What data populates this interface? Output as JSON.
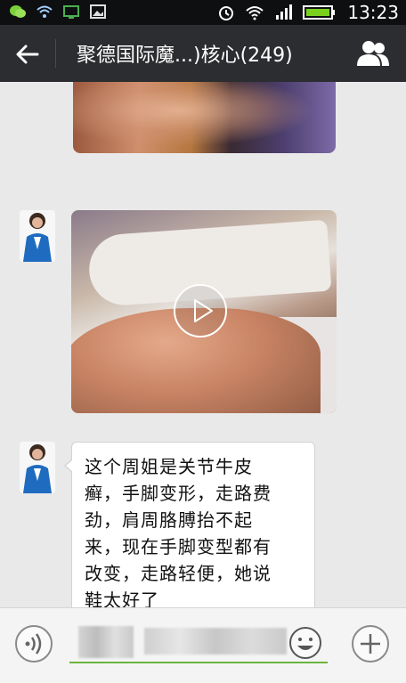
{
  "status_bar": {
    "time": "13:23",
    "icons": [
      "wechat-icon",
      "wifi-icon",
      "screen-icon",
      "image-icon",
      "alarm-icon",
      "wifi-signal-icon",
      "cell-signal-icon",
      "battery-icon"
    ]
  },
  "header": {
    "title": "聚德国际魔...)核心(249)",
    "back_icon": "back-arrow-icon",
    "members_icon": "group-members-icon"
  },
  "messages": [
    {
      "type": "image",
      "sender": "other"
    },
    {
      "type": "video",
      "sender": "other",
      "play_icon": "play-icon"
    },
    {
      "type": "text",
      "sender": "other",
      "lines": [
        "这个周姐是关节牛皮",
        "癣，手脚变形，走路费",
        "劲，肩周胳膊抬不起",
        "来，现在手脚变型都有",
        "改变，走路轻便，她说",
        "鞋太好了"
      ]
    }
  ],
  "input_bar": {
    "voice_icon": "voice-input-icon",
    "emoji_icon": "emoji-icon",
    "plus_icon": "plus-icon",
    "accent_color": "#6bb33c"
  },
  "colors": {
    "header_bg": "#2c2d30",
    "chat_bg": "#e9e9ea",
    "bubble_bg": "#ffffff"
  }
}
